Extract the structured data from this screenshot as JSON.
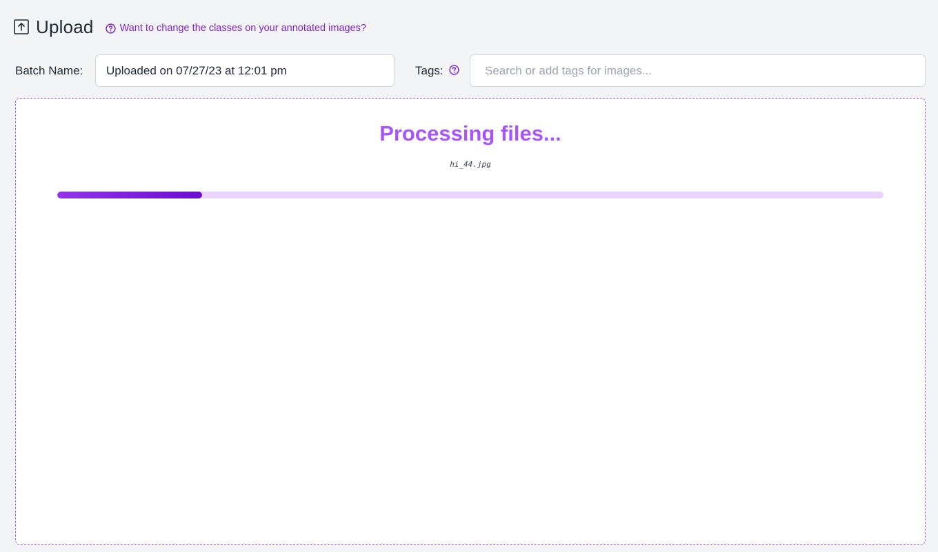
{
  "header": {
    "title": "Upload",
    "help_link": "Want to change the classes on your annotated images?"
  },
  "form": {
    "batch_label": "Batch Name:",
    "batch_value": "Uploaded on 07/27/23 at 12:01 pm",
    "tags_label": "Tags:",
    "tags_placeholder": "Search or add tags for images..."
  },
  "processing": {
    "title": "Processing files...",
    "current_file": "hi_44.jpg",
    "progress_fraction": 0.175
  },
  "icons": {
    "upload": "upload-icon",
    "help": "help-icon"
  },
  "colors": {
    "accent": "#a855f7",
    "accent_dark": "#6d0bd6",
    "link": "#7e22ce",
    "track": "#e9d5ff",
    "border_dashed": "#a855f7"
  }
}
